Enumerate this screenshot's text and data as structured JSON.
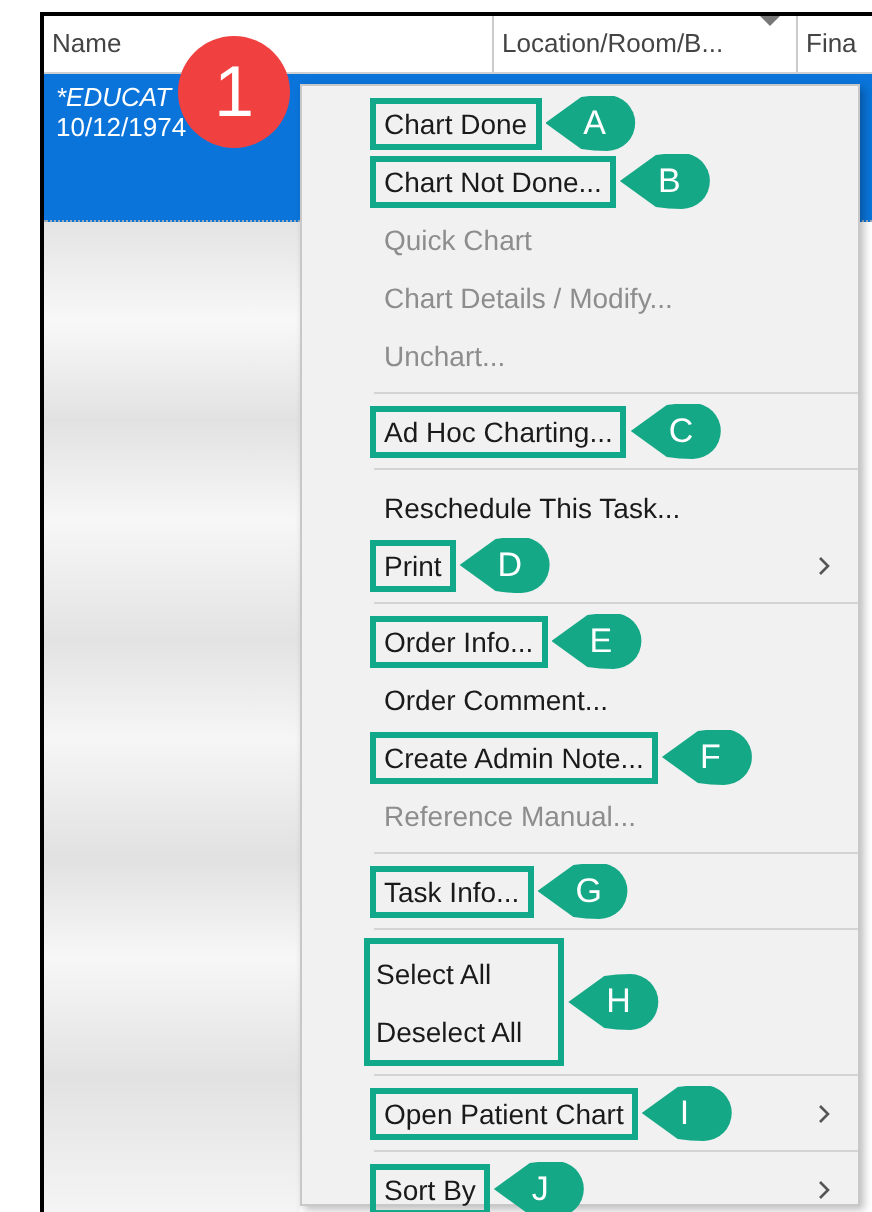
{
  "table": {
    "columns": [
      {
        "label": "Name"
      },
      {
        "label": "Location/Room/B...",
        "sorted": true
      },
      {
        "label": "Fina"
      }
    ],
    "rows": [
      {
        "selected": true,
        "name": "*EDUCAT",
        "dob": "10/12/1974"
      }
    ]
  },
  "step_badge": "1",
  "context_menu": {
    "items": [
      {
        "kind": "item",
        "label": "Chart Done",
        "disabled": false,
        "callout": "A"
      },
      {
        "kind": "item",
        "label": "Chart Not Done...",
        "disabled": false,
        "callout": "B"
      },
      {
        "kind": "item",
        "label": "Quick Chart",
        "disabled": true
      },
      {
        "kind": "item",
        "label": "Chart Details / Modify...",
        "disabled": true
      },
      {
        "kind": "item",
        "label": "Unchart...",
        "disabled": true
      },
      {
        "kind": "separator"
      },
      {
        "kind": "item",
        "label": "Ad Hoc Charting...",
        "disabled": false,
        "callout": "C"
      },
      {
        "kind": "separator"
      },
      {
        "kind": "item",
        "label": "Reschedule This Task...",
        "disabled": false
      },
      {
        "kind": "item",
        "label": "Print",
        "disabled": false,
        "submenu": true,
        "callout": "D"
      },
      {
        "kind": "separator"
      },
      {
        "kind": "item",
        "label": "Order Info...",
        "disabled": false,
        "callout": "E"
      },
      {
        "kind": "item",
        "label": "Order Comment...",
        "disabled": false
      },
      {
        "kind": "item",
        "label": "Create Admin Note...",
        "disabled": false,
        "callout": "F"
      },
      {
        "kind": "item",
        "label": "Reference Manual...",
        "disabled": true
      },
      {
        "kind": "separator"
      },
      {
        "kind": "item",
        "label": "Task Info...",
        "disabled": false,
        "callout": "G"
      },
      {
        "kind": "separator"
      },
      {
        "kind": "group",
        "callout": "H",
        "items": [
          {
            "label": "Select All",
            "disabled": false
          },
          {
            "label": "Deselect All",
            "disabled": false
          }
        ]
      },
      {
        "kind": "separator"
      },
      {
        "kind": "item",
        "label": "Open Patient Chart",
        "disabled": false,
        "submenu": true,
        "callout": "I"
      },
      {
        "kind": "separator"
      },
      {
        "kind": "item",
        "label": "Sort By",
        "disabled": false,
        "submenu": true,
        "callout": "J"
      }
    ]
  }
}
